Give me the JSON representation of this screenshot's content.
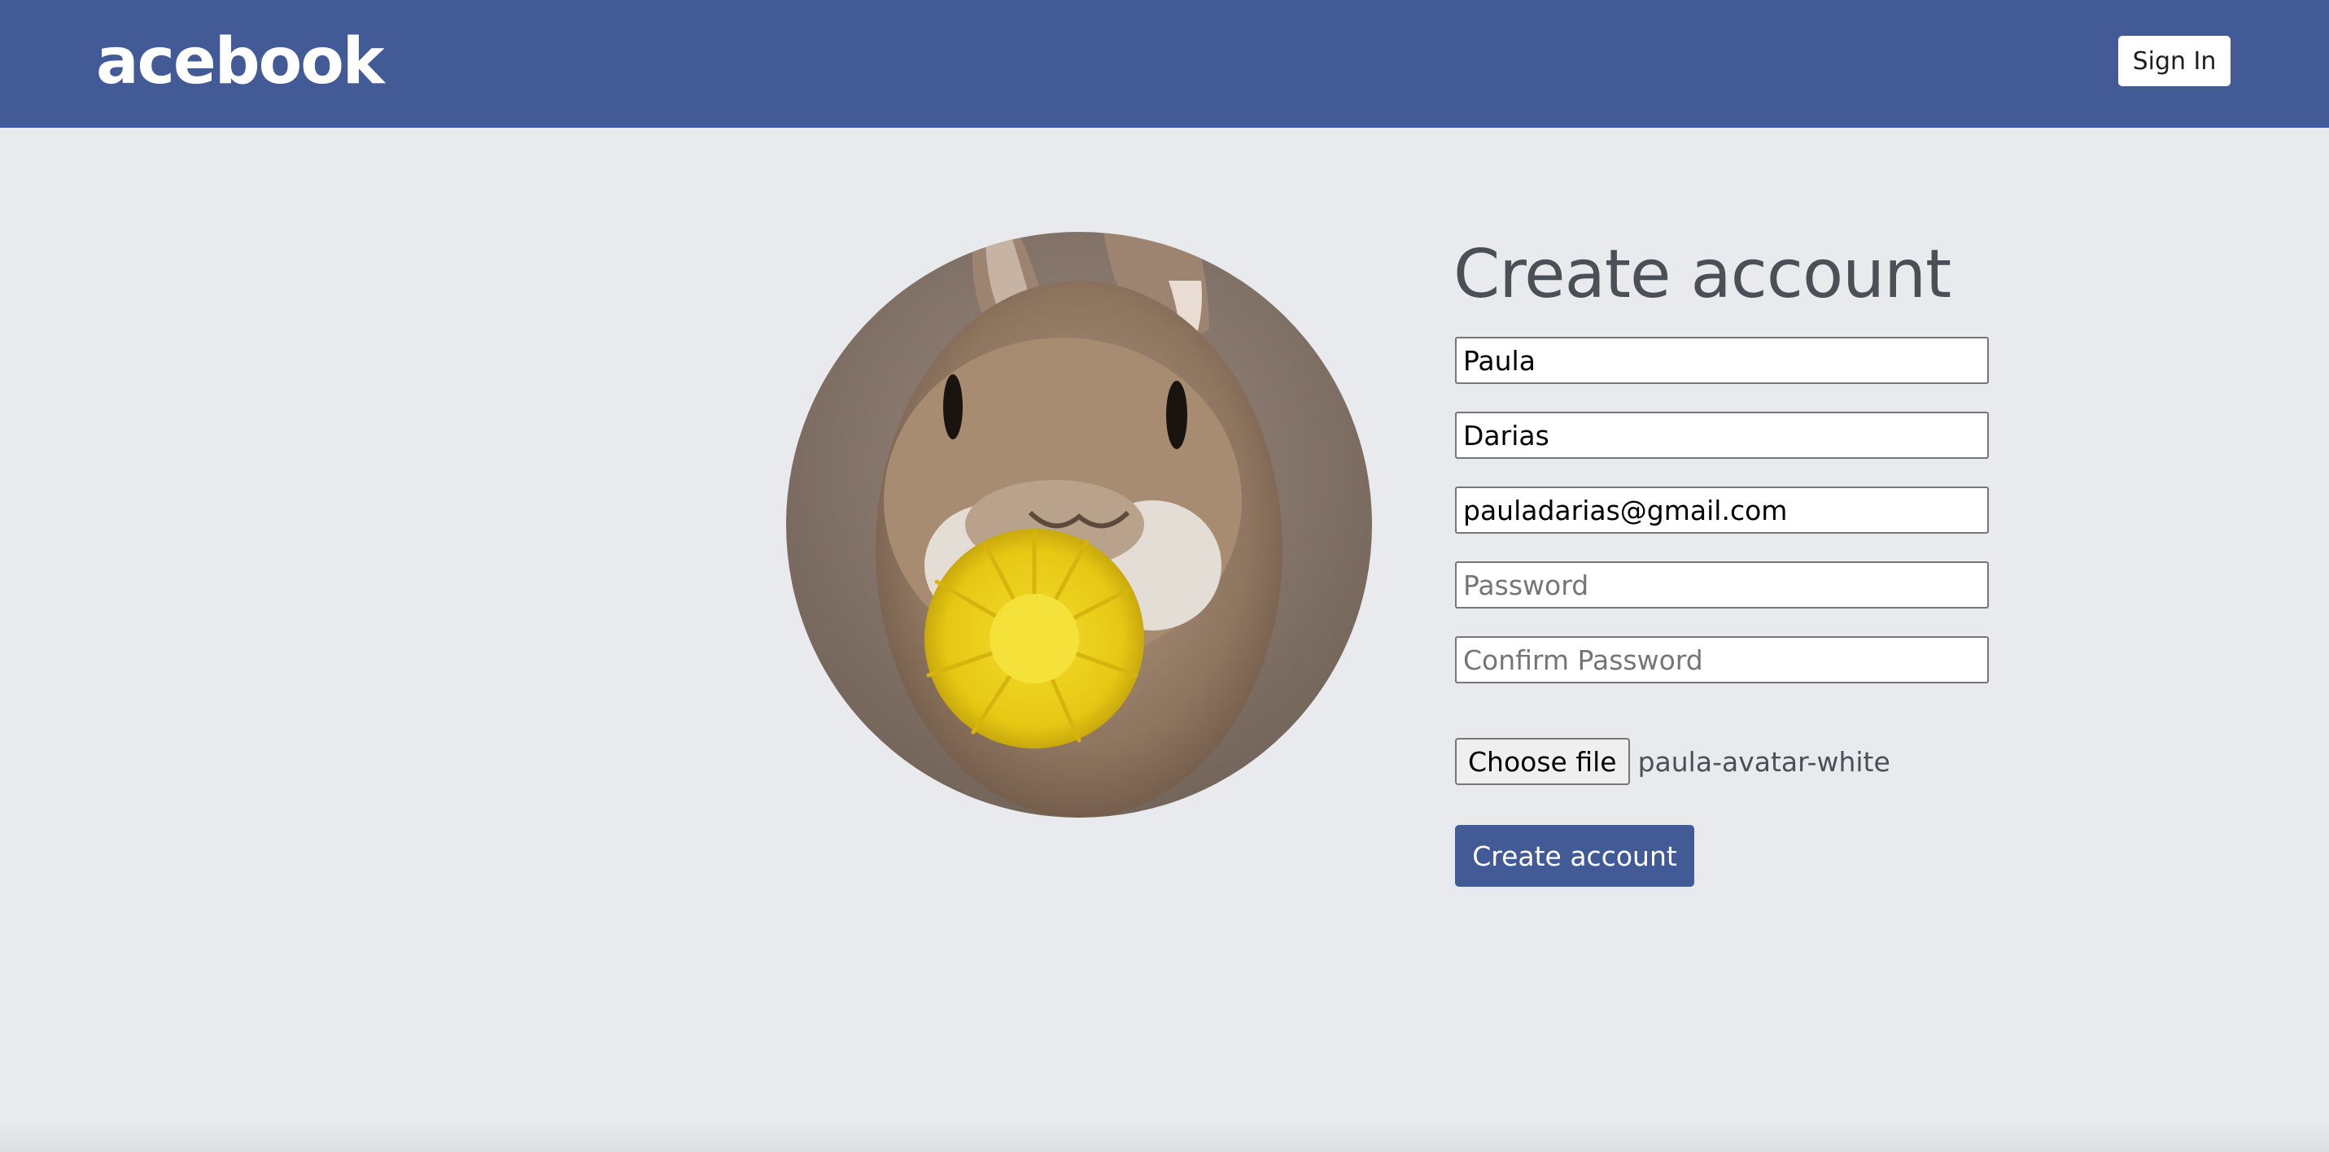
{
  "header": {
    "brand": "acebook",
    "sign_in_label": "Sign In"
  },
  "avatar": {
    "alt": "rabbit with dandelion"
  },
  "form": {
    "title": "Create account",
    "first_name": {
      "value": "Paula",
      "placeholder": ""
    },
    "last_name": {
      "value": "Darias",
      "placeholder": ""
    },
    "email": {
      "value": "pauladarias@gmail.com",
      "placeholder": ""
    },
    "password": {
      "value": "",
      "placeholder": "Password"
    },
    "confirm_password": {
      "value": "",
      "placeholder": "Confirm Password"
    },
    "file_button_label": "Choose file",
    "file_name": "paula-avatar-white",
    "submit_label": "Create account"
  },
  "colors": {
    "header_bg": "#425a96",
    "page_bg": "#e9eaed",
    "title_text": "#4b4f56",
    "button_bg": "#425a96"
  }
}
